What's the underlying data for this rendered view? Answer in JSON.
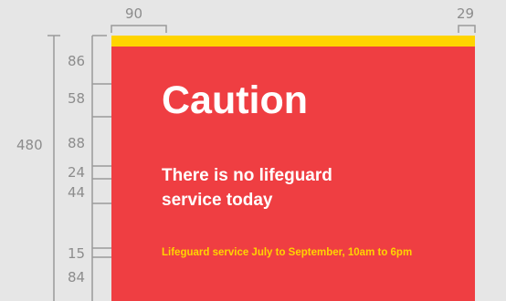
{
  "dimensions": {
    "left_margin": "90",
    "right_margin": "29",
    "total_height": "480",
    "spacings": [
      "86",
      "58",
      "88",
      "24",
      "44",
      "15",
      "84"
    ]
  },
  "sign": {
    "title": "Caution",
    "message_line1": "There is no lifeguard",
    "message_line2": "service today",
    "note": "Lifeguard service July to September, 10am to 6pm"
  },
  "colors": {
    "background": "#e6e6e6",
    "sign_red": "#ef3e42",
    "accent_yellow": "#ffd400",
    "sign_text": "#ffffff",
    "dimension_gray": "#8c8c8c"
  }
}
